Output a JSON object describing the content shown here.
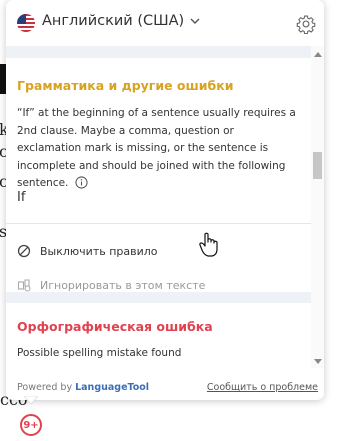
{
  "background": {
    "fragments": [
      "k",
      "c",
      "c",
      "s",
      "cco"
    ]
  },
  "header": {
    "language": "Английский (США)",
    "flag_icon": "us-flag-icon",
    "settings_icon": "gear-icon"
  },
  "grammar_card": {
    "title": "Грамматика и другие ошибки",
    "description": "“If” at the beginning of a sentence usually requires a 2nd clause. Maybe a comma, question or exclamation mark is missing, or the sentence is incomplete and should be joined with the following sentence.",
    "suggestion": "If",
    "actions": {
      "disable_rule": "Выключить правило",
      "ignore_in_text": "Игнорировать в этом тексте"
    },
    "title_color": "#d9a322"
  },
  "spelling_card": {
    "title": "Орфографическая ошибка",
    "description": "Possible spelling mistake found",
    "title_color": "#e0424f"
  },
  "footer": {
    "powered_by": "Powered by",
    "brand": "LanguageTool",
    "report": "Сообщить о проблеме"
  },
  "badge": {
    "count": "9+"
  }
}
